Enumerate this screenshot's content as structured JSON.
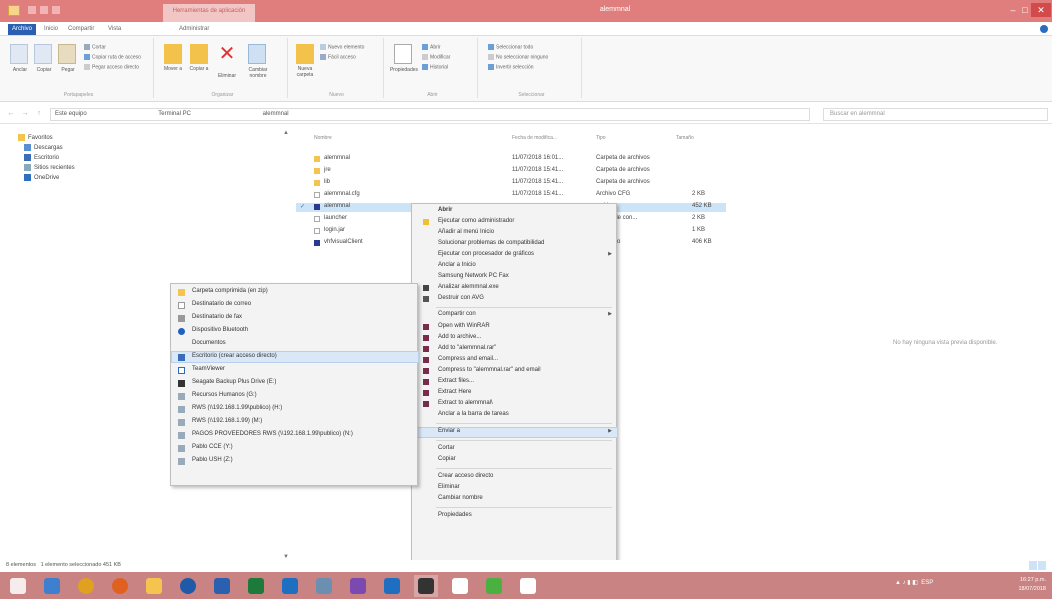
{
  "window": {
    "title": "alemmnal",
    "context_tab": "Herramientas de aplicación",
    "minimize": "–",
    "maximize": "□",
    "close": "✕"
  },
  "ribbon_tabs": [
    "Archivo",
    "Inicio",
    "Compartir",
    "Vista",
    "Administrar"
  ],
  "ribbon": {
    "portapapeles": {
      "label": "Portapapeles",
      "anclar": "Anclar",
      "copiar": "Copiar",
      "pegar": "Pegar",
      "cortar": "Cortar",
      "copiar_ruta": "Copiar ruta de acceso",
      "pegar_acceso": "Pegar acceso directo"
    },
    "organizar": {
      "label": "Organizar",
      "mover": "Mover a",
      "copiar": "Copiar a",
      "eliminar": "Eliminar",
      "cambiar_nombre": "Cambiar nombre"
    },
    "nuevo": {
      "label": "Nuevo",
      "nueva_carpeta": "Nueva carpeta",
      "nuevo_elemento": "Nuevo elemento",
      "facil_acceso": "Fácil acceso"
    },
    "abrir": {
      "label": "Abrir",
      "propiedades": "Propiedades",
      "abrir": "Abrir",
      "modificar": "Modificar",
      "historial": "Historial"
    },
    "seleccionar": {
      "label": "Seleccionar",
      "todo": "Seleccionar todo",
      "ninguno": "No seleccionar ninguno",
      "invertir": "Invertir selección"
    }
  },
  "address": {
    "path": [
      "Este equipo",
      "Terminal PC",
      "alemmnal"
    ],
    "search_placeholder": "Buscar en alemmnal",
    "back": "←",
    "forward": "→",
    "up": "↑"
  },
  "nav": {
    "items": [
      "Favoritos",
      "Descargas",
      "Escritorio",
      "Sitios recientes",
      "OneDrive"
    ]
  },
  "columns": [
    "Nombre",
    "Fecha de modifica...",
    "Tipo",
    "Tamaño"
  ],
  "files": [
    {
      "name": "alemmnal",
      "date": "11/07/2018 16:01...",
      "type": "Carpeta de archivos",
      "size": ""
    },
    {
      "name": "jre",
      "date": "11/07/2018 15:41...",
      "type": "Carpeta de archivos",
      "size": ""
    },
    {
      "name": "lib",
      "date": "11/07/2018 15:41...",
      "type": "Carpeta de archivos",
      "size": ""
    },
    {
      "name": "alemmnal.cfg",
      "date": "11/07/2018 15:41...",
      "type": "Archivo CFG",
      "size": "2 KB"
    },
    {
      "name": "alemmnal",
      "date": "",
      "type": "...ción",
      "size": "452 KB"
    },
    {
      "name": "launcher",
      "date": "",
      "type": "...ento de con...",
      "size": "2 KB"
    },
    {
      "name": "login.jar",
      "date": "",
      "type": "...JAR",
      "size": "1 KB"
    },
    {
      "name": "vhfvisualClient",
      "date": "",
      "type": "...archivo",
      "size": "406 KB"
    }
  ],
  "preview_message": "No hay ninguna vista previa disponible.",
  "context_menu": [
    "Abrir",
    "Ejecutar como administrador",
    "Añadir al menú Inicio",
    "Solucionar problemas de compatibilidad",
    "Ejecutar con procesador de gráficos",
    "Anclar a Inicio",
    "Samsung Network PC Fax",
    "Analizar alemmnal.exe",
    "Destruir con AVG",
    "Compartir con",
    "Open with WinRAR",
    "Add to archive...",
    "Add to \"alemmnal.rar\"",
    "Compress and email...",
    "Compress to \"alemmnal.rar\" and email",
    "Extract files...",
    "Extract Here",
    "Extract to alemmnal\\",
    "Anclar a la barra de tareas",
    "Enviar a",
    "Cortar",
    "Copiar",
    "Crear acceso directo",
    "Eliminar",
    "Cambiar nombre",
    "Propiedades"
  ],
  "send_to_menu": [
    "Carpeta comprimida (en zip)",
    "Destinatario de correo",
    "Destinatario de fax",
    "Dispositivo Bluetooth",
    "Documentos",
    "Escritorio (crear acceso directo)",
    "TeamViewer",
    "Seagate Backup Plus Drive (E:)",
    "Recursos Humanos (G:)",
    "RWS (\\\\192.168.1.99\\publico) (H:)",
    "RWS (\\\\192.168.1.99) (M:)",
    "PAGOS PROVEEDORES RWS (\\\\192.168.1.99\\publico) (N:)",
    "Pablo CCE (Y:)",
    "Pablo USH (Z:)"
  ],
  "status": {
    "items": "8 elementos",
    "selected": "1 elemento seleccionado  451 KB"
  },
  "taskbar": {
    "lang": "ESP",
    "time": "16:27 p.m.",
    "date": "18/07/2018"
  },
  "colors": {
    "titlebar": "#e07e7e",
    "taskbar": "#c98383",
    "selection": "#cce4f7",
    "menu_highlight": "#d9e7f7"
  }
}
